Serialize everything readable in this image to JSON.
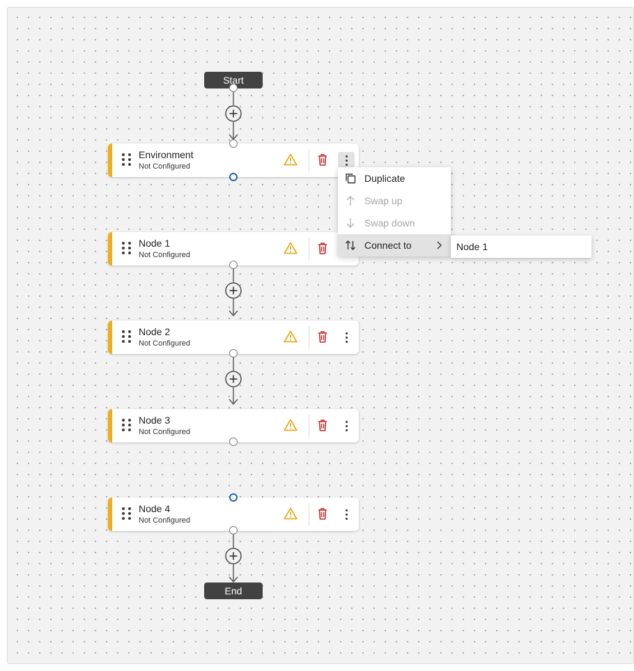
{
  "canvas": {
    "background": "#f2f2f2",
    "accent": "#f0ad18",
    "delete_color": "#c62828",
    "warning_color": "#e5a000",
    "port_active_color": "#1f5fbf"
  },
  "terminals": {
    "start_label": "Start",
    "end_label": "End"
  },
  "nodes": [
    {
      "title": "Environment",
      "status": "Not Configured"
    },
    {
      "title": "Node 1",
      "status": "Not Configured"
    },
    {
      "title": "Node 2",
      "status": "Not Configured"
    },
    {
      "title": "Node 3",
      "status": "Not Configured"
    },
    {
      "title": "Node 4",
      "status": "Not Configured"
    }
  ],
  "icons": {
    "drag": "drag-handle-icon",
    "warning": "warning-icon",
    "delete": "trash-icon",
    "more": "more-vertical-icon",
    "add": "add-circle-icon"
  },
  "context_menu": {
    "items": [
      {
        "label": "Duplicate",
        "icon": "duplicate-icon",
        "disabled": false
      },
      {
        "label": "Swap up",
        "icon": "arrow-up-icon",
        "disabled": true
      },
      {
        "label": "Swap down",
        "icon": "arrow-down-icon",
        "disabled": true
      },
      {
        "label": "Connect to",
        "icon": "swap-vertical-icon",
        "disabled": false,
        "has_submenu": true
      }
    ],
    "submenu": {
      "items": [
        {
          "label": "Node 1"
        }
      ]
    }
  }
}
